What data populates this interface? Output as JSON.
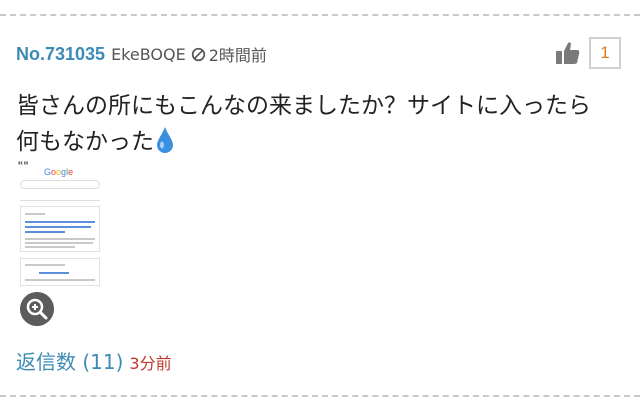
{
  "post": {
    "number": "No.731035",
    "user_id": "EkeBOQE",
    "posted_ago": "2時間前",
    "like_count": "1",
    "body_lines": [
      "皆さんの所にもこんなの来ましたか？サイトに入ったら",
      "何もなかった"
    ]
  },
  "replies": {
    "label": "返信数 (11)",
    "latest_ago": "3分前"
  },
  "colors": {
    "link": "#3c8bb7",
    "like_count": "#e07a1f",
    "reply_time": "#c0392b"
  },
  "icons": [
    "ban-icon",
    "thumbs-up-icon",
    "water-drop-icon",
    "zoom-in-icon"
  ]
}
